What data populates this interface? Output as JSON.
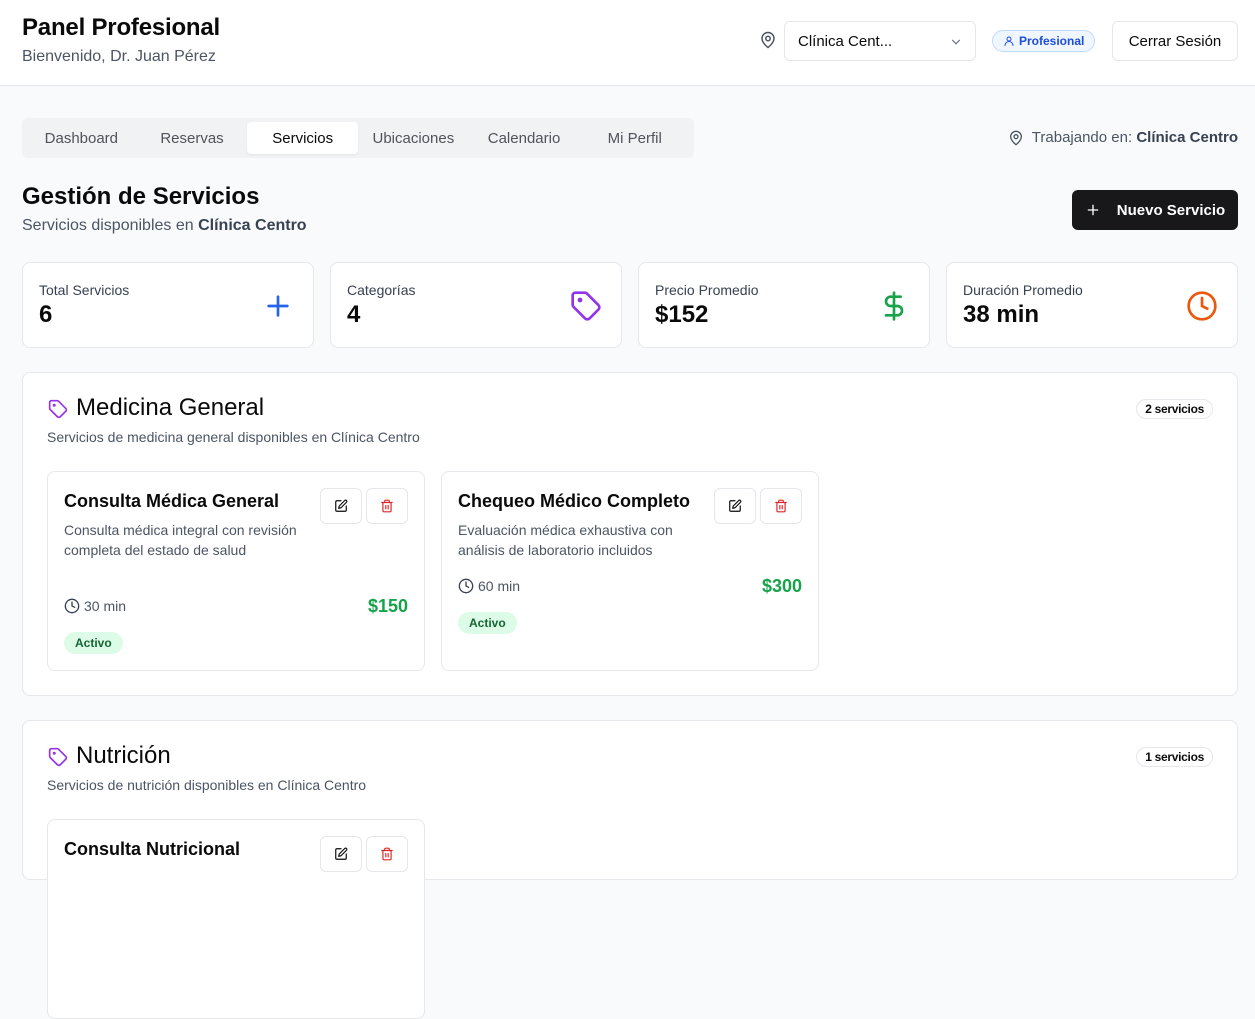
{
  "header": {
    "title": "Panel Profesional",
    "subtitle": "Bienvenido, Dr. Juan Pérez",
    "location_select": "Clínica Cent...",
    "role_badge": "Profesional",
    "logout_label": "Cerrar Sesión"
  },
  "tabs": [
    {
      "label": "Dashboard",
      "active": false
    },
    {
      "label": "Reservas",
      "active": false
    },
    {
      "label": "Servicios",
      "active": true
    },
    {
      "label": "Ubicaciones",
      "active": false
    },
    {
      "label": "Calendario",
      "active": false
    },
    {
      "label": "Mi Perfil",
      "active": false
    }
  ],
  "working": {
    "prefix": "Trabajando en:",
    "location": "Clínica Centro"
  },
  "page": {
    "title": "Gestión de Servicios",
    "subtitle_prefix": "Servicios disponibles en",
    "subtitle_location": "Clínica Centro",
    "new_button": "Nuevo Servicio"
  },
  "stats": [
    {
      "label": "Total Servicios",
      "value": "6",
      "icon": "plus-icon",
      "color": "#2563eb"
    },
    {
      "label": "Categorías",
      "value": "4",
      "icon": "tag-icon",
      "color": "#9333ea"
    },
    {
      "label": "Precio Promedio",
      "value": "$152",
      "icon": "dollar-icon",
      "color": "#16a34a"
    },
    {
      "label": "Duración Promedio",
      "value": "38 min",
      "icon": "clock-icon",
      "color": "#ea580c"
    }
  ],
  "categories": [
    {
      "title": "Medicina General",
      "description": "Servicios de medicina general disponibles en Clínica Centro",
      "count": "2 servicios",
      "services": [
        {
          "name": "Consulta Médica General",
          "description": "Consulta médica integral con revisión completa del estado de salud",
          "duration": "30 min",
          "price": "$150",
          "status": "Activo"
        },
        {
          "name": "Chequeo Médico Completo",
          "description": "Evaluación médica exhaustiva con análisis de laboratorio incluidos",
          "duration": "60 min",
          "price": "$300",
          "status": "Activo"
        }
      ]
    },
    {
      "title": "Nutrición",
      "description": "Servicios de nutrición disponibles en Clínica Centro",
      "count": "1 servicios",
      "services": [
        {
          "name": "Consulta Nutricional"
        }
      ]
    }
  ],
  "colors": {
    "accent_dark": "#18181b",
    "price_green": "#16a34a",
    "tag_purple": "#9333ea",
    "delete_red": "#dc2626"
  }
}
